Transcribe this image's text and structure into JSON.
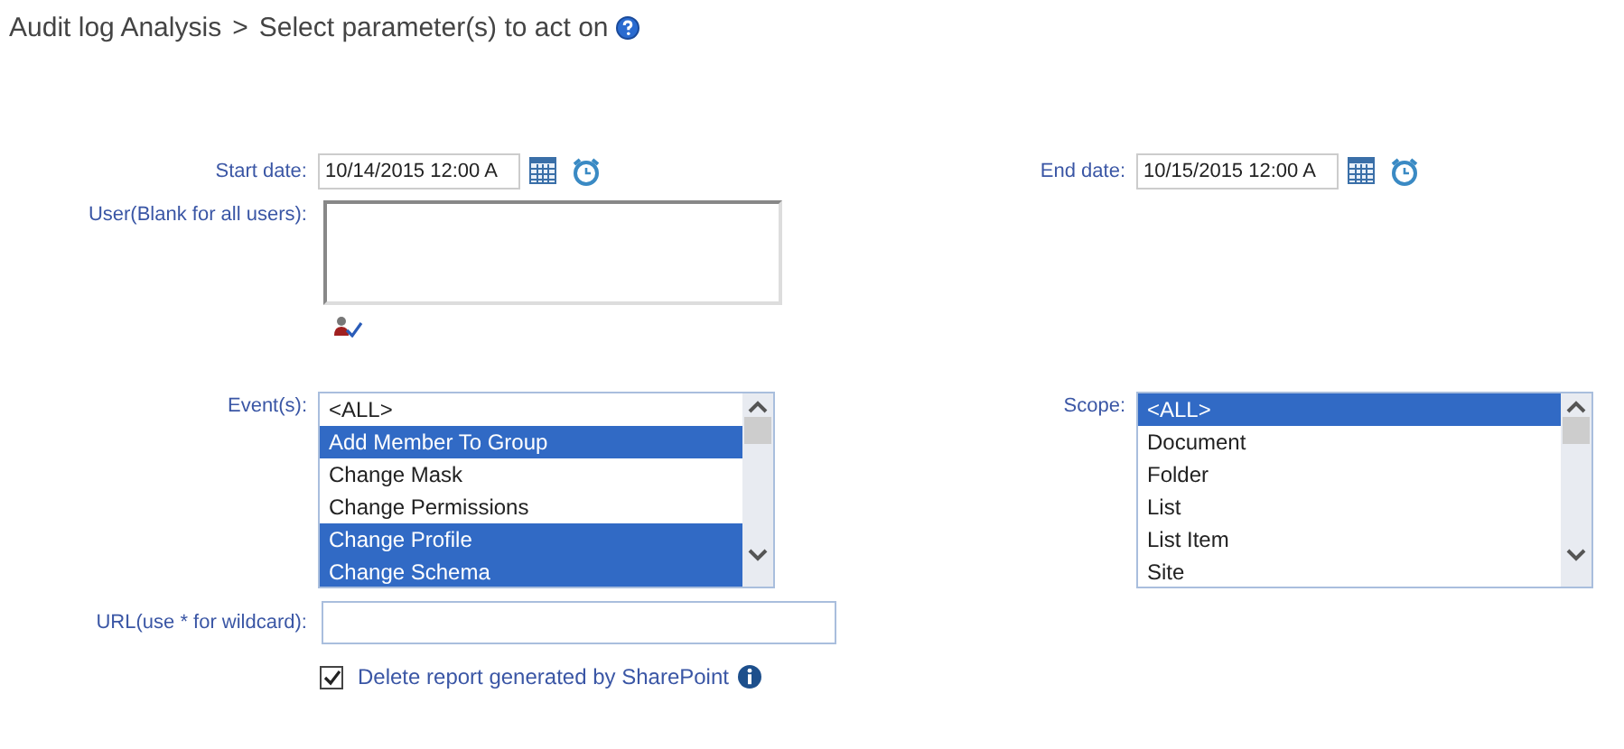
{
  "breadcrumb": {
    "root": "Audit log Analysis",
    "separator": ">",
    "current": "Select parameter(s) to act on"
  },
  "start_date": {
    "label": "Start date:",
    "value": "10/14/2015 12:00 A"
  },
  "end_date": {
    "label": "End date:",
    "value": "10/15/2015 12:00 A"
  },
  "user": {
    "label": "User(Blank for all users):"
  },
  "events": {
    "label": "Event(s):",
    "items": [
      {
        "label": "<ALL>",
        "selected": false
      },
      {
        "label": "Add Member To Group",
        "selected": true
      },
      {
        "label": "Change Mask",
        "selected": false
      },
      {
        "label": "Change Permissions",
        "selected": false
      },
      {
        "label": "Change Profile",
        "selected": true
      },
      {
        "label": "Change Schema",
        "selected": true
      }
    ]
  },
  "scope": {
    "label": "Scope:",
    "items": [
      {
        "label": "<ALL>",
        "selected": true
      },
      {
        "label": "Document",
        "selected": false
      },
      {
        "label": "Folder",
        "selected": false
      },
      {
        "label": "List",
        "selected": false
      },
      {
        "label": "List Item",
        "selected": false
      },
      {
        "label": "Site",
        "selected": false
      }
    ]
  },
  "url": {
    "label": "URL(use * for wildcard):"
  },
  "delete_report": {
    "label": "Delete report generated by SharePoint",
    "checked": true
  }
}
